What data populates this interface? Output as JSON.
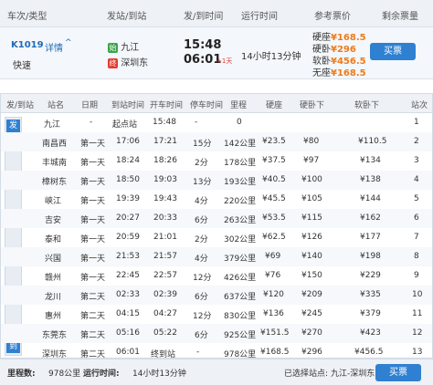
{
  "header": {
    "train_type": "车次/类型",
    "from_to": "发站/到站",
    "depart_arrive": "发/到时间",
    "duration": "运行时间",
    "ref_price": "参考票价",
    "remaining": "剩余票量"
  },
  "train": {
    "number": "K1019",
    "detail_link": "详情",
    "speed": "快速",
    "from_station": "九江",
    "to_station": "深圳东",
    "start_badge": "始",
    "end_badge": "终",
    "depart_time": "15:48",
    "arrive_time": "06:01",
    "plus_day": "+1天",
    "duration": "14小时13分钟",
    "prices": [
      {
        "label": "硬座",
        "value": "¥168.5"
      },
      {
        "label": "硬卧",
        "value": "¥296"
      },
      {
        "label": "软卧",
        "value": "¥456.5"
      },
      {
        "label": "无座",
        "value": "¥168.5"
      }
    ],
    "buy_label": "买票"
  },
  "columns": [
    "发/到站",
    "站名",
    "日期",
    "到站时间",
    "开车时间",
    "停车时间",
    "里程",
    "硬座",
    "硬卧下",
    "软卧下",
    "站次"
  ],
  "sidebar": {
    "start": "发",
    "end": "到"
  },
  "stops": [
    [
      "九江",
      "-",
      "起点站",
      "15:48",
      "-",
      "0",
      "",
      "",
      "",
      "1"
    ],
    [
      "南昌西",
      "第一天",
      "17:06",
      "17:21",
      "15分",
      "142公里",
      "¥23.5",
      "¥80",
      "¥110.5",
      "2"
    ],
    [
      "丰城南",
      "第一天",
      "18:24",
      "18:26",
      "2分",
      "178公里",
      "¥37.5",
      "¥97",
      "¥134",
      "3"
    ],
    [
      "樟树东",
      "第一天",
      "18:50",
      "19:03",
      "13分",
      "193公里",
      "¥40.5",
      "¥100",
      "¥138",
      "4"
    ],
    [
      "峡江",
      "第一天",
      "19:39",
      "19:43",
      "4分",
      "220公里",
      "¥45.5",
      "¥105",
      "¥144",
      "5"
    ],
    [
      "吉安",
      "第一天",
      "20:27",
      "20:33",
      "6分",
      "263公里",
      "¥53.5",
      "¥115",
      "¥162",
      "6"
    ],
    [
      "泰和",
      "第一天",
      "20:59",
      "21:01",
      "2分",
      "302公里",
      "¥62.5",
      "¥126",
      "¥177",
      "7"
    ],
    [
      "兴国",
      "第一天",
      "21:53",
      "21:57",
      "4分",
      "379公里",
      "¥69",
      "¥140",
      "¥198",
      "8"
    ],
    [
      "赣州",
      "第一天",
      "22:45",
      "22:57",
      "12分",
      "426公里",
      "¥76",
      "¥150",
      "¥229",
      "9"
    ],
    [
      "龙川",
      "第二天",
      "02:33",
      "02:39",
      "6分",
      "637公里",
      "¥120",
      "¥209",
      "¥335",
      "10"
    ],
    [
      "惠州",
      "第二天",
      "04:15",
      "04:27",
      "12分",
      "830公里",
      "¥136",
      "¥245",
      "¥379",
      "11"
    ],
    [
      "东莞东",
      "第二天",
      "05:16",
      "05:22",
      "6分",
      "925公里",
      "¥151.5",
      "¥270",
      "¥423",
      "12"
    ],
    [
      "深圳东",
      "第二天",
      "06:01",
      "终到站",
      "-",
      "978公里",
      "¥168.5",
      "¥296",
      "¥456.5",
      "13"
    ]
  ],
  "footer": {
    "mileage_label": "里程数:",
    "mileage_value": "978公里",
    "runtime_label": "运行时间:",
    "runtime_value": "14小时13分钟",
    "selected_label": "已选择站点:",
    "selected_value": "九江-深圳东",
    "buy_label": "买票"
  },
  "colors": {
    "accent": "#2f80d1",
    "price": "#f07a19",
    "start": "#3aa34a",
    "end": "#e33b2e"
  }
}
